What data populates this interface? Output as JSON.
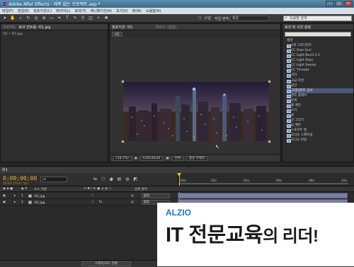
{
  "window": {
    "title": "Adobe After Effects - 제목 없는 프로젝트.aep *"
  },
  "menu": [
    "파일(F)",
    "편집(E)",
    "컴포지션(C)",
    "레이어(L)",
    "효과(T)",
    "애니메이션(A)",
    "보기(V)",
    "창(W)",
    "도움말(H)"
  ],
  "toolbar": {
    "snap_label": "스냅",
    "workspace_label": "작업 영역:",
    "workspace_value": "표준",
    "search_placeholder": "도움말 검색"
  },
  "project_panel": {
    "tab_label": "프로젝트",
    "tab2_label": "효과 컨트롤: 비1.jpg",
    "subtab": "비1 • 비1.jpg"
  },
  "comp_panel": {
    "tab_label": "컴포지션: 비1",
    "tab2_label": "레이어: (없음)",
    "subtab": "비1",
    "zoom": "(18.7%)",
    "timecode": "0;00;00;00",
    "view": "전체",
    "camera": "활성 카메라"
  },
  "effects_panel": {
    "tab_label": "효과 및 사전 설정",
    "search_value": "",
    "group": "생성",
    "items": [
      "4색 그라디언트",
      "CC Glue Gun",
      "CC Light Burst 2.5",
      "CC Light Rays",
      "CC Light Sweep",
      "CC Threads",
      "격자",
      "고급 조명",
      "광선",
      "그라디언트 공사",
      "렌즈 플레어",
      "번개",
      "셀 패턴",
      "쓰기",
      "원",
      "선 그리기",
      "음 패턴",
      "스포이트 칠",
      "오디오 스펙트럼",
      "오디오 파형"
    ],
    "selected_index": 9
  },
  "timeline": {
    "tab_label": "비1",
    "timecode": "0;00;00;00",
    "fps": "00000 (29.97 fps)",
    "ruler_ticks": [
      "00s",
      "02s",
      "04s",
      "06s",
      "08s",
      "10s"
    ],
    "col_layer_name": "소스 이름",
    "col_parent": "상위 항목",
    "layers": [
      {
        "num": "1",
        "name": "비1.jpg",
        "parent": "없음"
      },
      {
        "num": "2",
        "name": "비1.jpg",
        "parent": "없음"
      }
    ],
    "bottom_button": "스위치/모드 전환"
  },
  "overlay": {
    "brand": "ALZIO",
    "slogan_main": "IT 전문교육",
    "slogan_tail": "의 리더!"
  }
}
